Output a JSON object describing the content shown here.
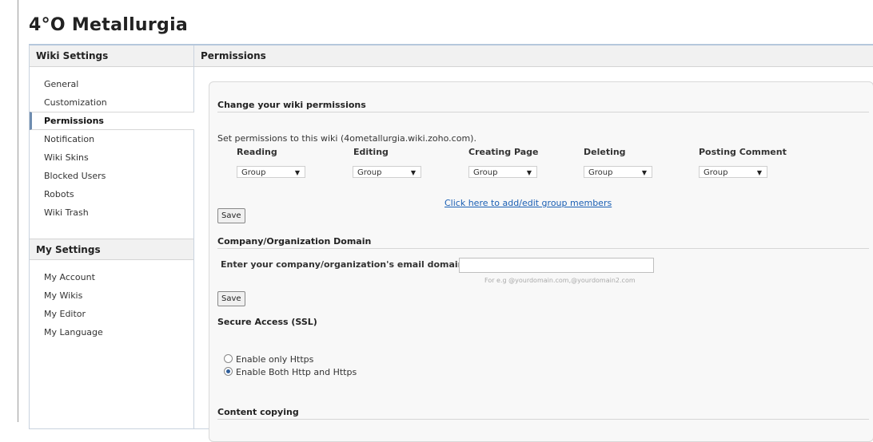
{
  "header": {
    "top_text": "4°O Metallurgia — ...",
    "site_title": "4°O Metallurgia"
  },
  "sidebar": {
    "wiki_settings_heading": "Wiki Settings",
    "wiki_items": [
      {
        "label": "General"
      },
      {
        "label": "Customization"
      },
      {
        "label": "Permissions",
        "active": true
      },
      {
        "label": "Notification"
      },
      {
        "label": "Wiki Skins"
      },
      {
        "label": "Blocked Users"
      },
      {
        "label": "Robots"
      },
      {
        "label": "Wiki Trash"
      }
    ],
    "my_settings_heading": "My Settings",
    "my_items": [
      {
        "label": "My Account"
      },
      {
        "label": "My Wikis"
      },
      {
        "label": "My Editor"
      },
      {
        "label": "My Language"
      }
    ]
  },
  "main": {
    "heading": "Permissions",
    "permissions": {
      "section_title": "Change your wiki permissions",
      "description": "Set permissions to this wiki (4ometallurgia.wiki.zoho.com).",
      "columns": [
        {
          "label": "Reading",
          "value": "Group"
        },
        {
          "label": "Editing",
          "value": "Group"
        },
        {
          "label": "Creating Page",
          "value": "Group"
        },
        {
          "label": "Deleting",
          "value": "Group"
        },
        {
          "label": "Posting Comment",
          "value": "Group"
        }
      ],
      "group_link": "Click here to add/edit group members",
      "save_label": "Save"
    },
    "domain": {
      "section_title": "Company/Organization Domain",
      "field_label": "Enter your company/organization's email domains",
      "field_value": "",
      "hint": "For e.g @yourdomain.com,@yourdomain2.com",
      "save_label": "Save"
    },
    "ssl": {
      "section_title": "Secure Access (SSL)",
      "options": [
        {
          "label": "Enable only Https",
          "selected": false
        },
        {
          "label": "Enable Both Http and Https",
          "selected": true
        }
      ]
    },
    "copying": {
      "section_title": "Content copying"
    }
  }
}
